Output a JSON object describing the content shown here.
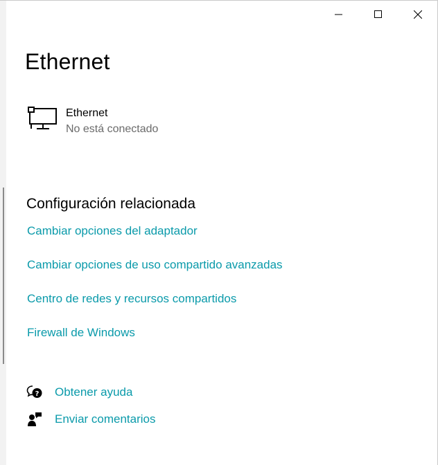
{
  "window": {
    "minimize_icon": "minimize-icon",
    "maximize_icon": "maximize-icon",
    "close_icon": "close-icon"
  },
  "page": {
    "title": "Ethernet"
  },
  "connection": {
    "icon": "ethernet-network-icon",
    "name": "Ethernet",
    "status": "No está conectado"
  },
  "related": {
    "title": "Configuración relacionada",
    "links": [
      "Cambiar opciones del adaptador",
      "Cambiar opciones de uso compartido avanzadas",
      "Centro de redes y recursos compartidos",
      "Firewall de Windows"
    ]
  },
  "support": {
    "help_icon": "chat-help-icon",
    "help_label": "Obtener ayuda",
    "feedback_icon": "feedback-icon",
    "feedback_label": "Enviar comentarios"
  },
  "colors": {
    "link": "#0a9aaa",
    "secondary_text": "#6b6b6b"
  }
}
